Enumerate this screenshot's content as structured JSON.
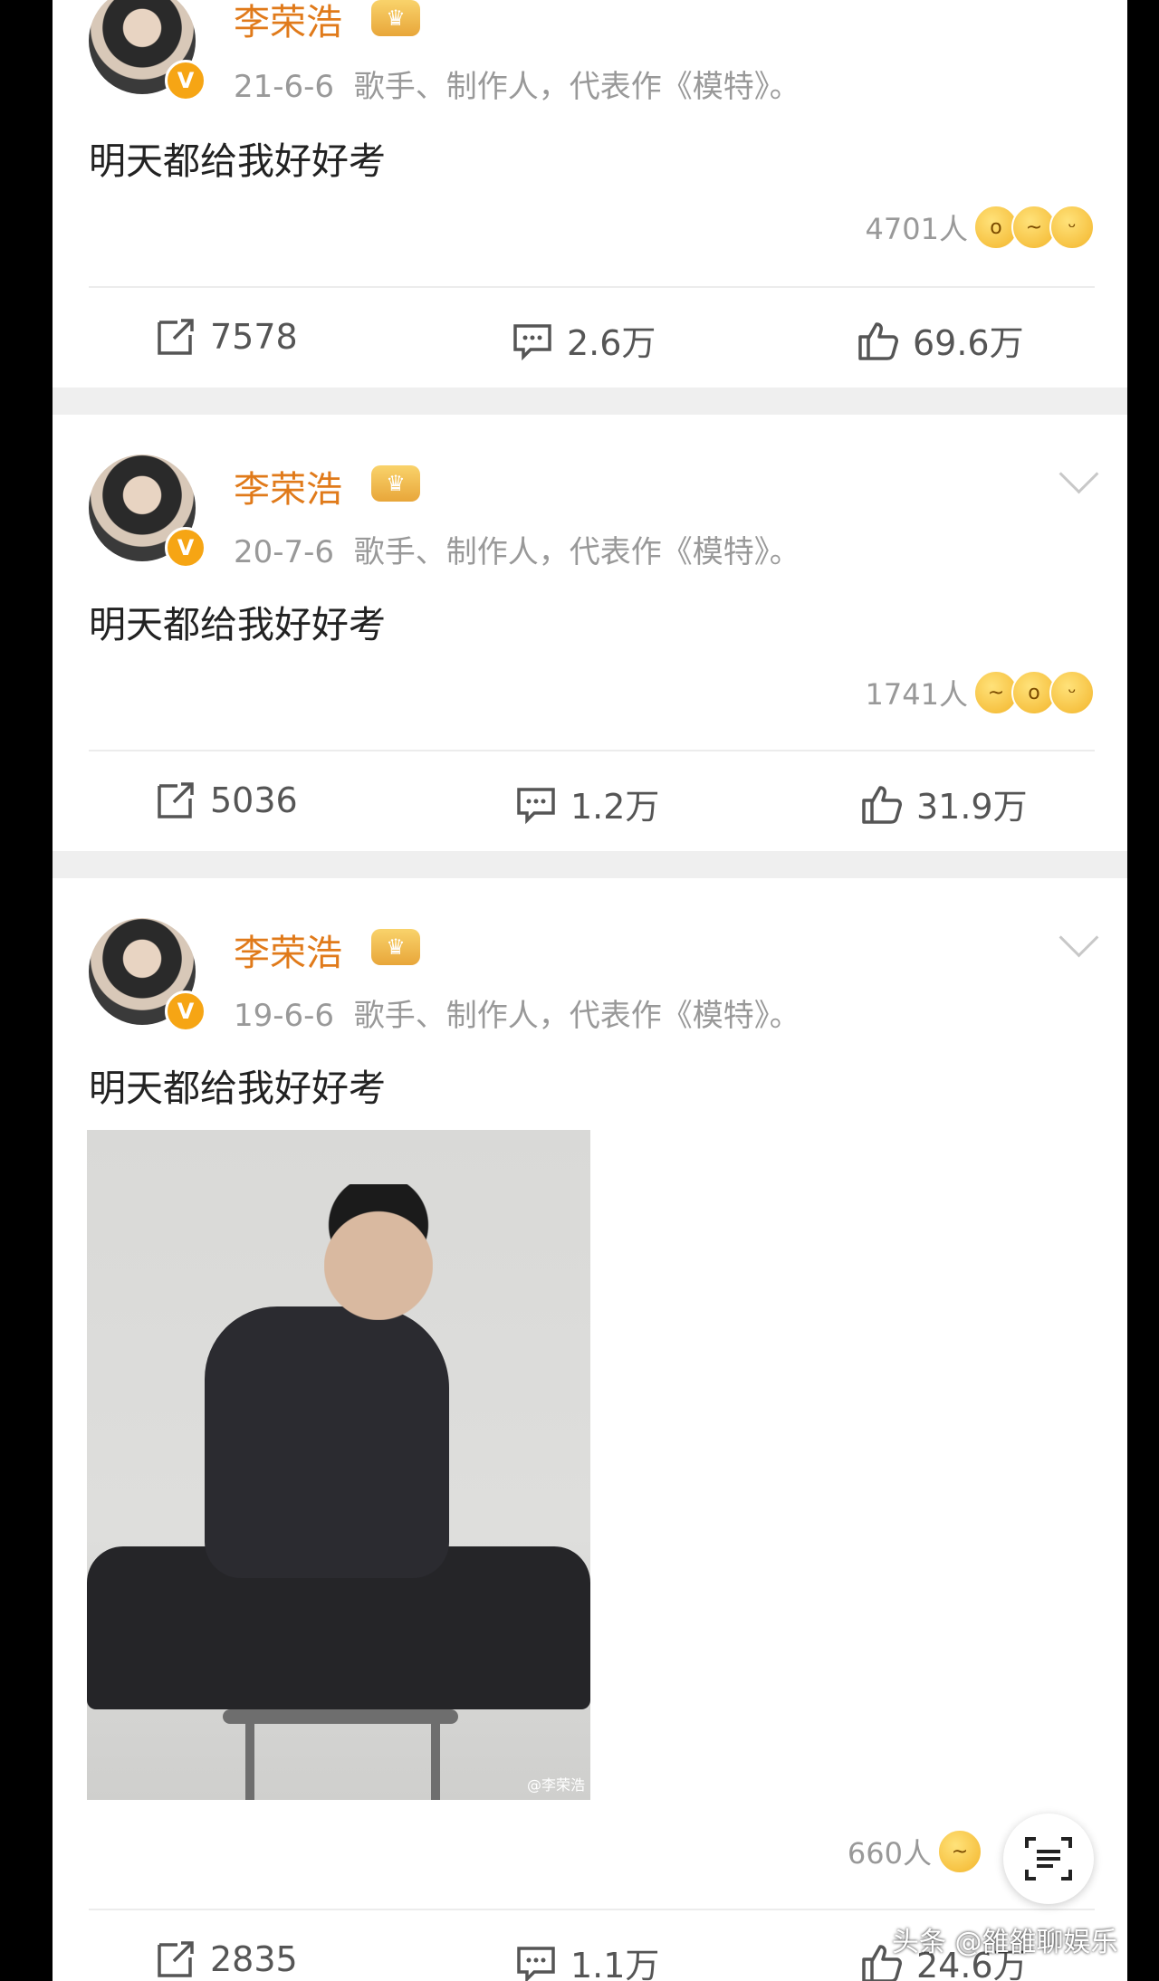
{
  "posts": [
    {
      "author": "李荣浩",
      "date": "21-6-6",
      "bio": "歌手、制作人，代表作《模特》。",
      "text": "明天都给我好好考",
      "reaction_count": "4701人",
      "reposts": "7578",
      "comments": "2.6万",
      "likes": "69.6万"
    },
    {
      "author": "李荣浩",
      "date": "20-7-6",
      "bio": "歌手、制作人，代表作《模特》。",
      "text": "明天都给我好好考",
      "reaction_count": "1741人",
      "reposts": "5036",
      "comments": "1.2万",
      "likes": "31.9万"
    },
    {
      "author": "李荣浩",
      "date": "19-6-6",
      "bio": "歌手、制作人，代表作《模特》。",
      "text": "明天都给我好好考",
      "image_watermark": "@李荣浩",
      "reaction_count": "660人",
      "reposts": "2835",
      "comments": "1.1万",
      "likes": "24.6万"
    }
  ],
  "verified_badge": "V",
  "overlay_watermark": "头条 @雒雒聊娱乐",
  "colors": {
    "name": "#e07a1a",
    "badge": "#f6a514",
    "meta": "#999999",
    "background": "#efefef"
  },
  "icons": [
    "repost-icon",
    "comment-icon",
    "like-icon",
    "crown-icon",
    "chevron-down-icon",
    "scan-icon"
  ]
}
